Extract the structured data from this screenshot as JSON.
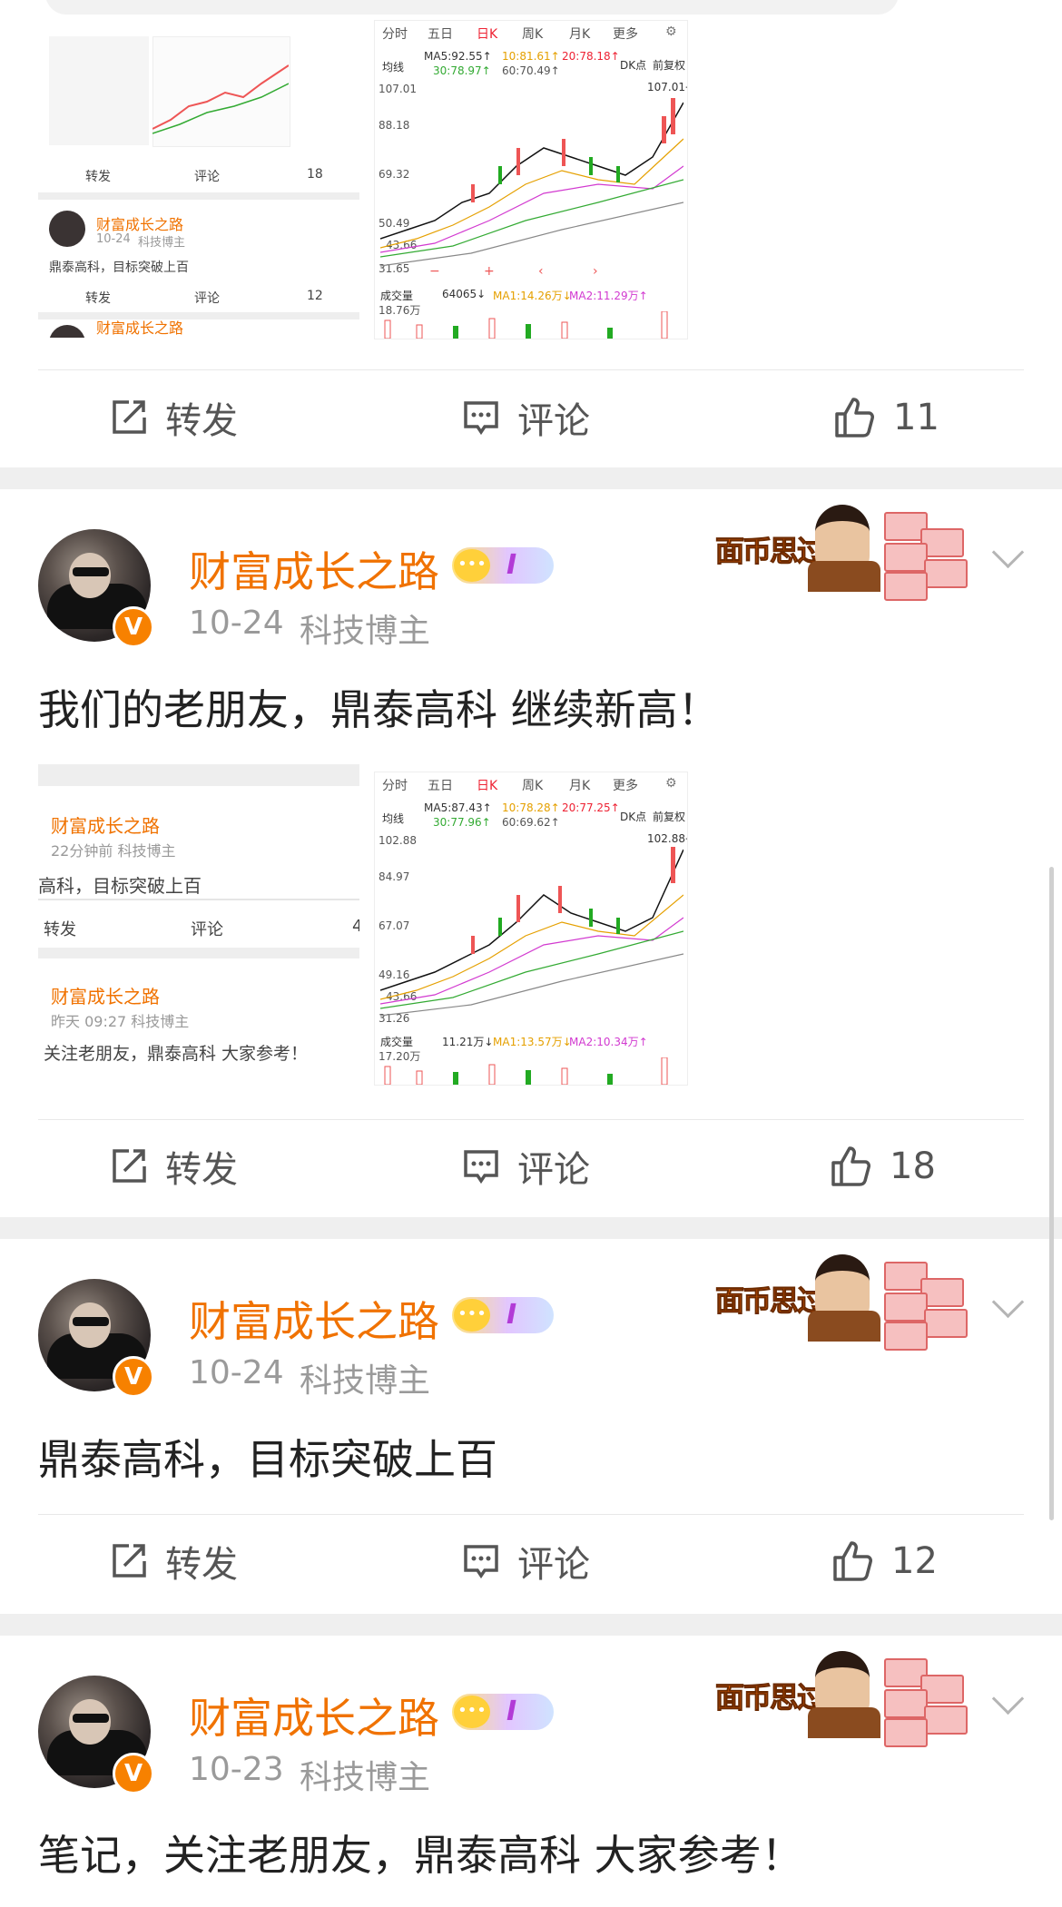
{
  "feed": {
    "actions": {
      "repost": "转发",
      "comment": "评论"
    },
    "top_card": {
      "like_count": "11",
      "thumb_left": {
        "user_name": "财富成长之路",
        "date": "10-24",
        "role": "科技博主",
        "text": "鼎泰高科，目标突破上百",
        "repost": "转发",
        "comment": "评论",
        "likes_top": "18",
        "likes_mid": "12"
      },
      "thumb_chart": {
        "tabs": [
          "分时",
          "五日",
          "日K",
          "周K",
          "月K",
          "更多"
        ],
        "ma_line": "均线",
        "ma5": "MA5:92.55↑",
        "ma10": "10:81.61↑",
        "ma20": "20:78.18↑",
        "ma30": "30:78.97↑",
        "ma60": "60:70.49↑",
        "dk": "DK点",
        "fq": "前复权",
        "price_top": "107.01",
        "price_right": "107.01→",
        "levels": [
          "107.01",
          "88.18",
          "69.32",
          "50.49",
          "43.66",
          "31.65"
        ],
        "vol_label": "成交量",
        "vol_val": "64065↓",
        "vol_ma1": "MA1:14.26万↓",
        "vol_ma2": "MA2:11.29万↑",
        "vol_top": "18.76万"
      }
    },
    "posts": [
      {
        "user_name": "财富成长之路",
        "badge": "I",
        "vip_badge": "V",
        "banner_text": "面币思过",
        "date": "10-24",
        "role": "科技博主",
        "content": "我们的老朋友，鼎泰高科 继续新高！",
        "like_count": "18",
        "thumb_left": {
          "item1_name": "财富成长之路",
          "item1_meta": "22分钟前   科技博主",
          "item1_text": "高科，目标突破上百",
          "repost": "转发",
          "comment": "评论",
          "likes": "4",
          "item2_name": "财富成长之路",
          "item2_meta": "昨天 09:27   科技博主",
          "item2_text": "关注老朋友，鼎泰高科 大家参考！"
        },
        "thumb_chart": {
          "tabs": [
            "分时",
            "五日",
            "日K",
            "周K",
            "月K",
            "更多"
          ],
          "ma_line": "均线",
          "ma5": "MA5:87.43↑",
          "ma10": "10:78.28↑",
          "ma20": "20:77.25↑",
          "ma30": "30:77.96↑",
          "ma60": "60:69.62↑",
          "dk": "DK点",
          "fq": "前复权",
          "price_top": "102.88",
          "price_right": "102.88→",
          "levels": [
            "102.88",
            "84.97",
            "67.07",
            "49.16",
            "43.66",
            "31.26"
          ],
          "vol_label": "成交量",
          "vol_val": "11.21万↓",
          "vol_ma1": "MA1:13.57万↓",
          "vol_ma2": "MA2:10.34万↑",
          "vol_top": "17.20万"
        }
      },
      {
        "user_name": "财富成长之路",
        "badge": "I",
        "vip_badge": "V",
        "banner_text": "面币思过",
        "date": "10-24",
        "role": "科技博主",
        "content": "鼎泰高科，目标突破上百",
        "like_count": "12"
      },
      {
        "user_name": "财富成长之路",
        "badge": "I",
        "vip_badge": "V",
        "banner_text": "面币思过",
        "date": "10-23",
        "role": "科技博主",
        "content": "笔记，关注老朋友，鼎泰高科 大家参考！"
      }
    ]
  },
  "colors": {
    "accent": "#f07200",
    "name": "#f07200",
    "separator": "#efefef"
  }
}
